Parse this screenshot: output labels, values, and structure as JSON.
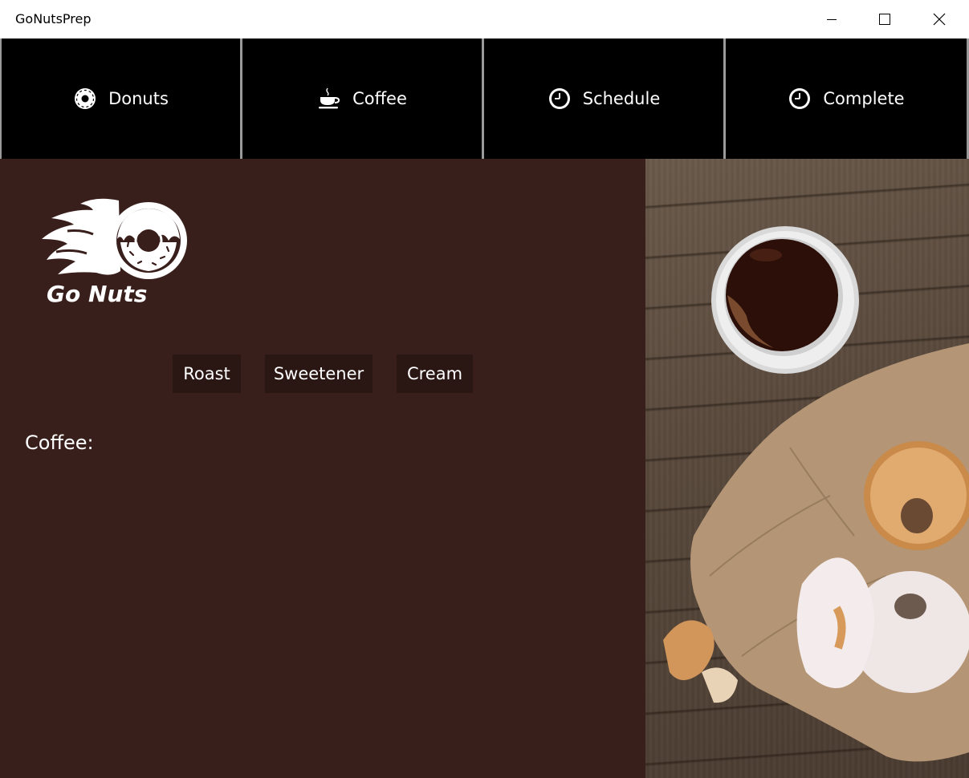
{
  "window": {
    "title": "GoNutsPrep",
    "controls": [
      "minimize-icon",
      "maximize-icon",
      "close-icon"
    ]
  },
  "nav": {
    "items": [
      {
        "label": "Donuts",
        "icon": "donut-icon"
      },
      {
        "label": "Coffee",
        "icon": "coffee-cup-icon"
      },
      {
        "label": "Schedule",
        "icon": "clock-icon"
      },
      {
        "label": "Complete",
        "icon": "clock-icon"
      }
    ]
  },
  "logo": {
    "text": "Go Nuts"
  },
  "options": {
    "roast": "Roast",
    "sweetener": "Sweetener",
    "cream": "Cream"
  },
  "summary": {
    "coffee_label": "Coffee:"
  },
  "colors": {
    "nav_bg": "#000000",
    "main_bg": "#391f1b",
    "button_bg": "#2a1613",
    "text": "#ffffff"
  }
}
